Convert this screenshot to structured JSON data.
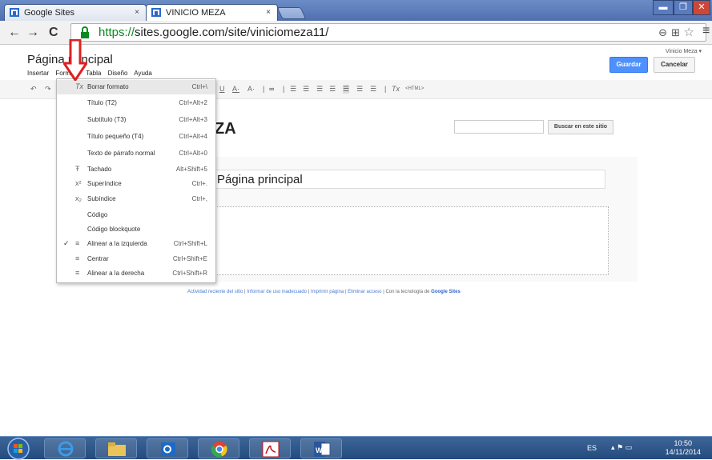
{
  "browser": {
    "tabs": [
      {
        "title": "Google Sites",
        "close": "×"
      },
      {
        "title": "VINICIO MEZA",
        "close": "×"
      }
    ],
    "window_controls": [
      "▬",
      "❐",
      "✕"
    ],
    "nav": {
      "back": "←",
      "forward": "→",
      "reload": "C"
    },
    "url_scheme": "https://",
    "url_rest": "sites.google.com/site/viniciomeza11/",
    "right_icons": [
      "⊖",
      "⊞",
      "☆",
      "≡"
    ]
  },
  "sites": {
    "page_title": "Página principal",
    "user": "Vinicio Meza ▾",
    "save": "Guardar",
    "cancel": "Cancelar",
    "menu": [
      "Insertar",
      "Formato",
      "Tabla",
      "Diseño",
      "Ayuda"
    ],
    "site_name": "ZA",
    "search_button": "Buscar en este sitio",
    "title_field": "Página principal",
    "footer": {
      "activity": "Actividad reciente del sitio",
      "sep1": "|",
      "report": "Informar de uso inadecuado",
      "sep2": "|",
      "print": "Imprimir página",
      "sep3": "|",
      "remove": "Eliminar acceso",
      "sep4": "|",
      "powered": "Con la tecnología de",
      "brand": "Google Sites"
    },
    "edit_tools": [
      "↶",
      "↷",
      "U",
      "A·",
      "A·",
      "|",
      "∞",
      "|",
      "☰",
      "☰",
      "☰",
      "☰",
      "☰",
      "☰",
      "☰",
      "|",
      "Tx",
      "<HTML>"
    ]
  },
  "dropdown": {
    "items": [
      {
        "icon": "Tx",
        "label": "Borrar formato",
        "shortcut": "Ctrl+\\",
        "highlight": true
      },
      {
        "icon": "",
        "label": "Título (T2)",
        "shortcut": "Ctrl+Alt+2"
      },
      {
        "icon": "",
        "label": "Subtítulo (T3)",
        "shortcut": "Ctrl+Alt+3"
      },
      {
        "icon": "",
        "label": "Título pequeño (T4)",
        "shortcut": "Ctrl+Alt+4"
      },
      {
        "icon": "",
        "label": "Texto de párrafo normal",
        "shortcut": "Ctrl+Alt+0"
      },
      {
        "icon": "Ŧ",
        "label": "Tachado",
        "shortcut": "Alt+Shift+5"
      },
      {
        "icon": "x²",
        "label": "Superíndice",
        "shortcut": "Ctrl+."
      },
      {
        "icon": "x₂",
        "label": "Subíndice",
        "shortcut": "Ctrl+,"
      },
      {
        "icon": "",
        "label": "Código",
        "shortcut": ""
      },
      {
        "icon": "",
        "label": "Código blockquote",
        "shortcut": ""
      },
      {
        "icon": "≡",
        "label": "Alinear a la izquierda",
        "shortcut": "Ctrl+Shift+L",
        "check": "✓"
      },
      {
        "icon": "≡",
        "label": "Centrar",
        "shortcut": "Ctrl+Shift+E"
      },
      {
        "icon": "≡",
        "label": "Alinear a la derecha",
        "shortcut": "Ctrl+Shift+R"
      }
    ]
  },
  "taskbar": {
    "lang": "ES",
    "time": "10:50",
    "date": "14/11/2014",
    "tray": "▴  ⚑  ▭"
  },
  "colors": {
    "accent": "#4d90fe",
    "arrow": "#e02020",
    "https_green": "#0a8a1f"
  }
}
